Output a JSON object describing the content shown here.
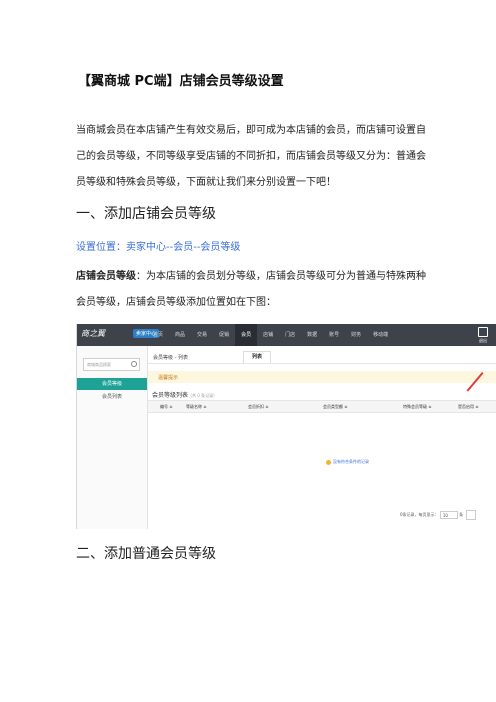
{
  "doc": {
    "title": "【翼商城 PC端】店铺会员等级设置",
    "intro": "当商城会员在本店铺产生有效交易后，即可成为本店铺的会员，而店铺可设置自己的会员等级，不同等级享受店铺的不同折扣，而店铺会员等级又分为：普通会员等级和特殊会员等级，下面就让我们来分别设置一下吧！",
    "section1_heading": "一、添加店铺会员等级",
    "location": "设置位置：卖家中心--会员--会员等级",
    "desc_label": "店铺会员等级",
    "desc_text": "：为本店铺的会员划分等级，店铺会员等级可分为普通与特殊两种会员等级，店铺会员等级添加位置如在下图：",
    "section2_heading": "二、添加普通会员等级"
  },
  "screenshot": {
    "logo": "商之翼",
    "logo_badge": "卖家中心",
    "nav": [
      "首页",
      "商品",
      "交易",
      "促销",
      "会员",
      "店铺",
      "门店",
      "数据",
      "账号",
      "财务",
      "移动端"
    ],
    "nav_active_index": 4,
    "exit_label": "退出",
    "search_placeholder": "商城商品搜索",
    "side_active": "会员等级",
    "side_item": "会员列表",
    "breadcrumb": "会员等级 - 列表",
    "tab": "列表",
    "tip": "温馨提示",
    "list_title": "会员等级列表",
    "list_count": "（共 0 条记录）",
    "columns": [
      "编号 ≑",
      "等级名称 ≑",
      "会员折扣 ≑",
      "会员类型额 ≑",
      "特殊会员等级 ≑",
      "是否启用 ≑"
    ],
    "empty_text": "没有符合条件的记录",
    "pager_label": "0条记录，每页显示：",
    "pager_size": "10",
    "pager_unit": "条"
  }
}
